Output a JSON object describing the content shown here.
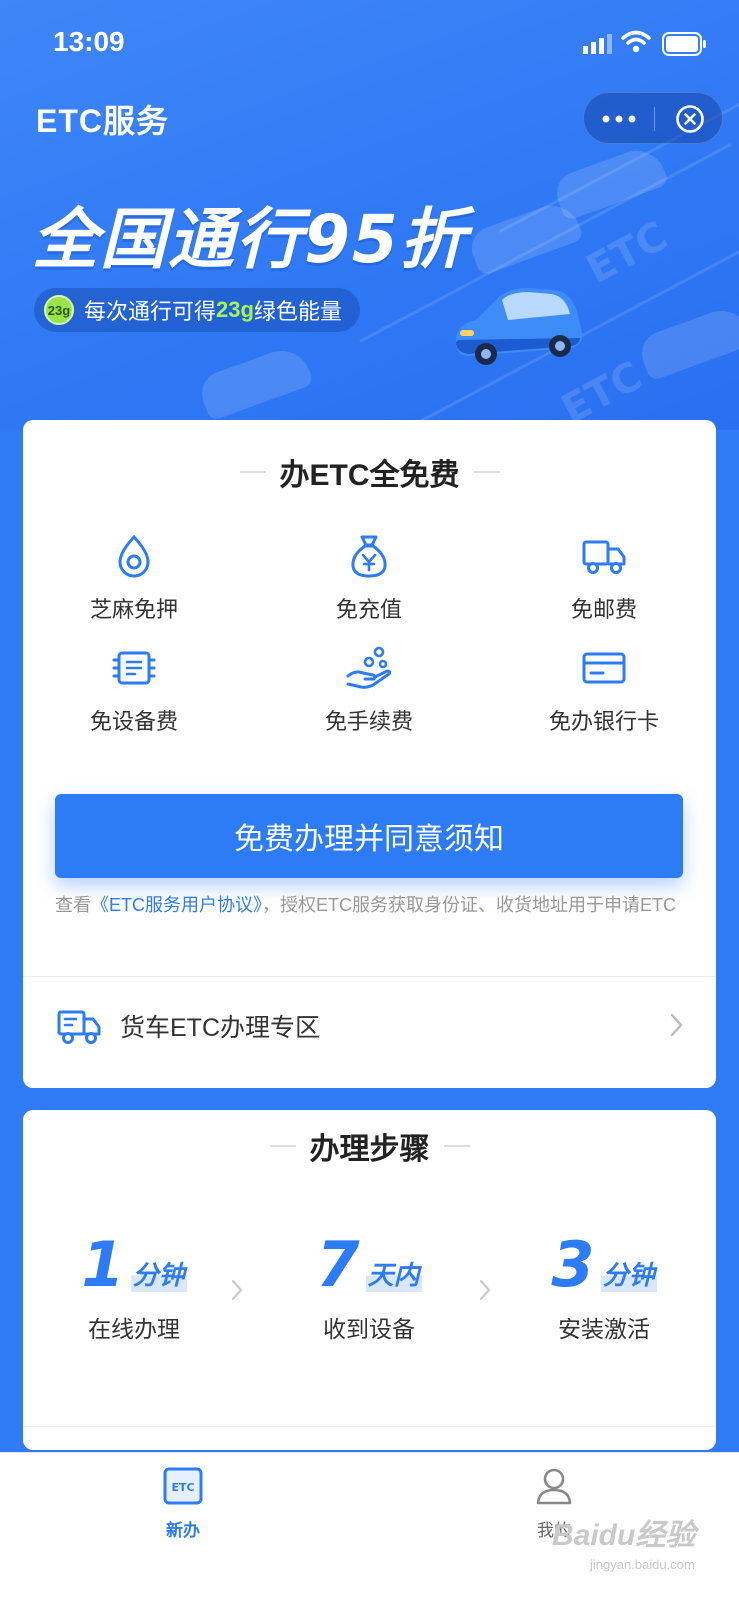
{
  "status_bar": {
    "time": "13:09"
  },
  "header": {
    "title": "ETC服务"
  },
  "hero": {
    "slogan": "全国通行95折",
    "badge": "23g",
    "energy_prefix": "每次通行可得",
    "energy_amount": "23g",
    "energy_suffix": "绿色能量"
  },
  "free_card": {
    "title": "办ETC全免费",
    "features": [
      {
        "label": "芝麻免押",
        "icon": "drop-icon"
      },
      {
        "label": "免充值",
        "icon": "money-bag-icon"
      },
      {
        "label": "免邮费",
        "icon": "truck-icon"
      },
      {
        "label": "免设备费",
        "icon": "device-icon"
      },
      {
        "label": "免手续费",
        "icon": "hand-coins-icon"
      },
      {
        "label": "免办银行卡",
        "icon": "bank-card-icon"
      }
    ],
    "button_label": "免费办理并同意须知",
    "agreement_prefix": "查看",
    "agreement_link": "《ETC服务用户协议》",
    "agreement_suffix": "，授权ETC服务获取身份证、收货地址用于申请ETC",
    "truck_zone_label": "货车ETC办理专区"
  },
  "steps_card": {
    "title": "办理步骤",
    "steps": [
      {
        "num": "1",
        "unit": "分钟",
        "label": "在线办理"
      },
      {
        "num": "7",
        "unit": "天内",
        "label": "收到设备"
      },
      {
        "num": "3",
        "unit": "分钟",
        "label": "安装激活"
      }
    ]
  },
  "tabbar": {
    "tabs": [
      {
        "label": "新办",
        "icon_text": "ETC",
        "active": true
      },
      {
        "label": "我的",
        "active": false
      }
    ]
  },
  "watermark": {
    "text": "Baidu经验",
    "sub": "jingyan.baidu.com"
  },
  "colors": {
    "primary": "#2d7cf6",
    "hero_bg": "#2f7bf6",
    "energy_green": "#a5f25b"
  }
}
